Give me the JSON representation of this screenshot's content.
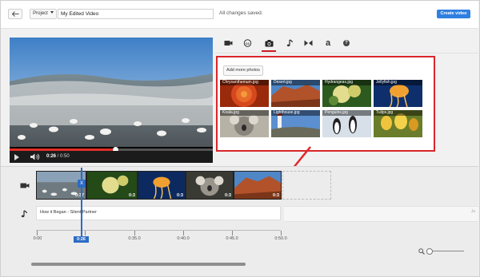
{
  "toolbar": {
    "project_label": "Project",
    "video_title": "My Edited Video",
    "save_status": "All changes saved.",
    "create_label": "Create video"
  },
  "player": {
    "current_time": "0:26",
    "total_time": "0:50",
    "progress": 0.52
  },
  "tabs": [
    {
      "icon": "video-camera-icon",
      "active": false
    },
    {
      "icon": "creative-commons-icon",
      "active": false
    },
    {
      "icon": "photo-camera-icon",
      "active": true
    },
    {
      "icon": "music-note-icon",
      "active": false
    },
    {
      "icon": "transitions-icon",
      "active": false
    },
    {
      "icon": "text-icon",
      "active": false,
      "glyph": "a"
    },
    {
      "icon": "help-icon",
      "active": false,
      "glyph": "?"
    }
  ],
  "photos": {
    "add_label": "Add more photos",
    "items": [
      {
        "name": "Chrysanthemum.jpg",
        "color": "#c8401b"
      },
      {
        "name": "Desert.jpg",
        "color": "#b1502a"
      },
      {
        "name": "Hydrangeas.jpg",
        "color": "#c8c36a"
      },
      {
        "name": "Jellyfish.jpg",
        "color": "#1f4e93"
      },
      {
        "name": "Koala.jpg",
        "color": "#8d8a83"
      },
      {
        "name": "Lighthouse.jpg",
        "color": "#3f72b8"
      },
      {
        "name": "Penguins.jpg",
        "color": "#cfd9e2"
      },
      {
        "name": "Tulips.jpg",
        "color": "#d7a42a"
      }
    ]
  },
  "timeline": {
    "clips": [
      {
        "name": "birds-clip",
        "duration": "0:37"
      },
      {
        "name": "hydrangeas-clip",
        "duration": "0:3"
      },
      {
        "name": "jellyfish-clip",
        "duration": "0:3"
      },
      {
        "name": "koala-clip",
        "duration": "0:3"
      },
      {
        "name": "desert-clip",
        "duration": "0:3"
      }
    ],
    "audio_title": "How it Began - Silent Partner",
    "audio_ghost_label": "Ja",
    "playhead_time": "0:26",
    "playhead_marker": "X",
    "ruler_labels": [
      "0:00",
      "0:30.0",
      "0:35.0",
      "0:40.0",
      "0:45.0",
      "0:50.0"
    ]
  }
}
